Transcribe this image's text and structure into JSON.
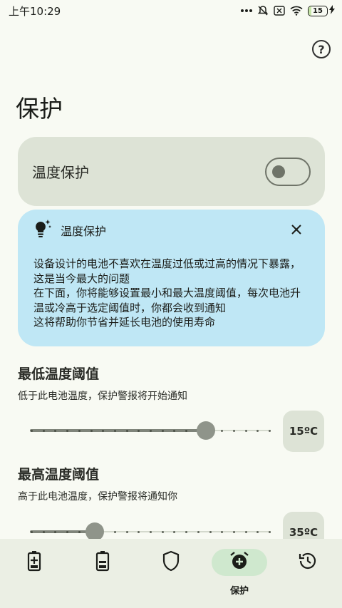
{
  "status_bar": {
    "time": "上午10:29",
    "battery_level": "15",
    "battery_fraction": 0.15
  },
  "page": {
    "title": "保护"
  },
  "temperature_toggle": {
    "label": "温度保护",
    "enabled": false
  },
  "info_card": {
    "title": "温度保护",
    "lines": [
      "设备设计的电池不喜欢在温度过低或过高的情况下暴露，这是当今最大的问题",
      "在下面，你将能够设置最小和最大温度阈值，每次电池升温或冷高于选定阈值时，你都会收到通知",
      "这将帮助你节省并延长电池的使用寿命"
    ]
  },
  "min_threshold": {
    "title": "最低温度阈值",
    "subtitle": "低于此电池温度，保护警报将开始通知",
    "value_label": "15ºC",
    "fraction": 0.75
  },
  "max_threshold": {
    "title": "最高温度阈值",
    "subtitle": "高于此电池温度，保护警报将通知你",
    "value_label": "35ºC",
    "fraction": 0.25
  },
  "bottom_nav": {
    "items": [
      {
        "icon": "battery-charging-icon",
        "label": ""
      },
      {
        "icon": "battery-icon",
        "label": ""
      },
      {
        "icon": "shield-icon",
        "label": ""
      },
      {
        "icon": "alarm-add-icon",
        "label": "保护",
        "active": true
      },
      {
        "icon": "history-icon",
        "label": ""
      }
    ]
  },
  "colors": {
    "background": "#f8faf3",
    "card": "#dde3d6",
    "info_card": "#bfe7f5",
    "nav_background": "#ebefe4",
    "nav_active_pill": "#cfe8ce"
  }
}
